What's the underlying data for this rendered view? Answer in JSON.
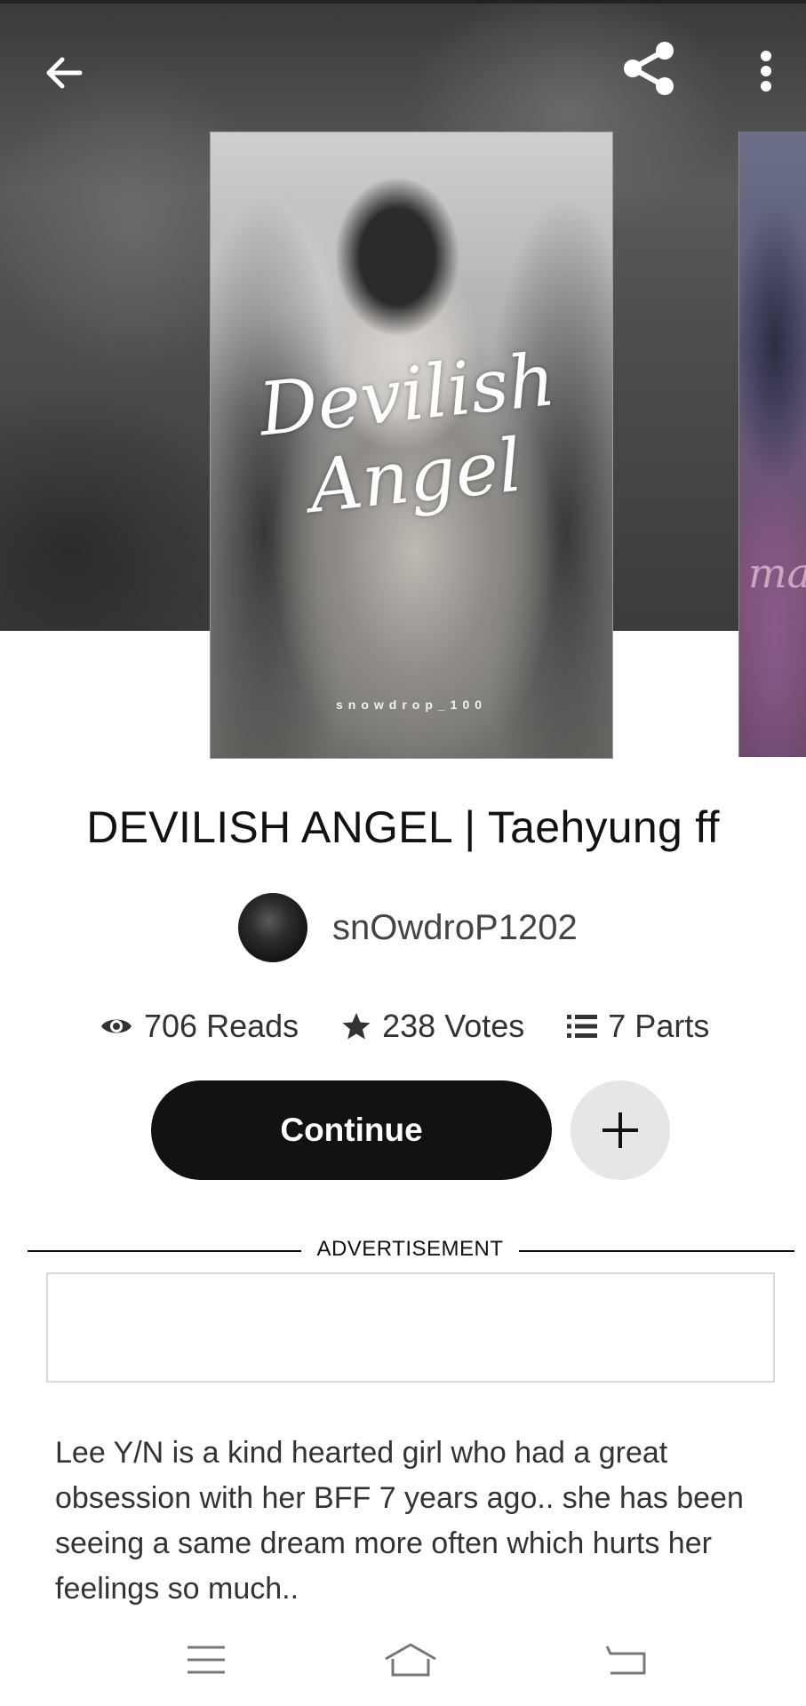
{
  "header": {
    "back_icon": "arrow-left-icon",
    "share_icon": "share-icon",
    "more_icon": "more-vertical-icon"
  },
  "cover": {
    "title_art": "Devilish\nAngel",
    "credit": "snowdrop_100"
  },
  "next_cover": {
    "title_fragment": "ma"
  },
  "story": {
    "title": "DEVILISH ANGEL | Taehyung ff",
    "author": "snOwdroP1202"
  },
  "stats": {
    "reads": "706 Reads",
    "votes": "238 Votes",
    "parts": "7 Parts"
  },
  "actions": {
    "continue_label": "Continue"
  },
  "ad": {
    "label": "ADVERTISEMENT"
  },
  "description": "Lee Y/N is a kind hearted girl who had a great obsession with her BFF 7 years ago.. she has been seeing a same dream more often which hurts her feelings so much..",
  "system_nav": {
    "items": [
      "menu-icon",
      "home-icon",
      "back-icon"
    ]
  },
  "colors": {
    "primary_button": "#121212",
    "secondary_button": "#e6e6e6",
    "text": "#121212",
    "muted_text": "#444444"
  }
}
